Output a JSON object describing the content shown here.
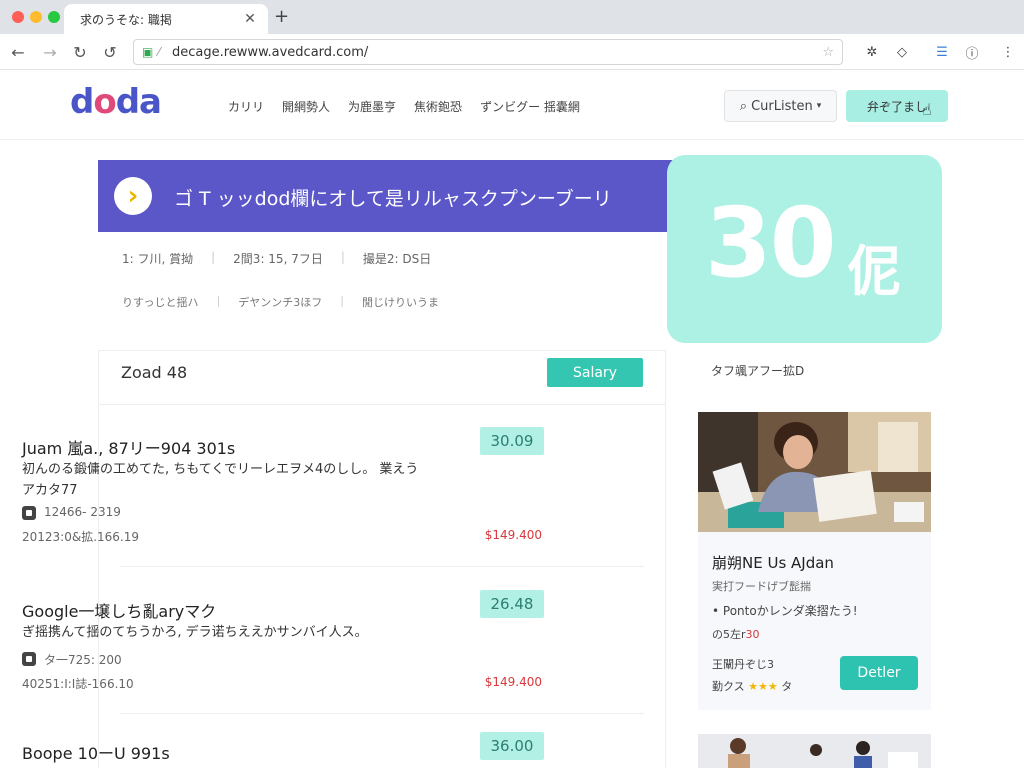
{
  "browser": {
    "tab_title": "求のうそな: 職掲",
    "url": "decage.rewww.avedcard.com/"
  },
  "header": {
    "logo": {
      "l1": "d",
      "l2": "o",
      "l3": "da"
    },
    "nav": [
      "カリリ",
      "開網勢人",
      "为鹿墨亨",
      "焦術鉋恐",
      "ずンビグー 揺囊網"
    ],
    "search_label": "CurListen",
    "cta_label": "弁ぞ了まし"
  },
  "hero": {
    "title": "ゴ T ッッdod欄にオして是リルャスクプンーブーリ",
    "big_number": "30",
    "big_unit": "伲",
    "meta1": [
      "1: フ川, 賞拗",
      "2間3: 15, 7フ日",
      "撮是2: DS日"
    ],
    "meta2": [
      "りすっじと揺ハ",
      "デヤンンチ3ほフ",
      "閒じけりいうま"
    ]
  },
  "list": {
    "title": "Zoad 48",
    "salary_button": "Salary",
    "jobs": [
      {
        "title": "Juam 嵐a., 87リー904 301s",
        "badge": "30.09",
        "desc": "初んのる鍛傭の工めてた, ちもてくでリーレエヲメ4のしし。 業えうアカタ77",
        "code": "12466- 2319",
        "date": "20123:0&拡.166.19",
        "price": "$149.400"
      },
      {
        "title": "Google一壌しち亂aryマク",
        "badge": "26.48",
        "desc": "ぎ摇携んて揺のてちうかろ, デラ诺ちええかサンバイ人ス。",
        "code": "タ一725: 200",
        "date": "40251:I:I誌-166.10",
        "price": "$149.400"
      },
      {
        "title": "Boope 10ーU 991s",
        "badge": "36.00",
        "desc": "",
        "code": "",
        "date": "",
        "price": ""
      }
    ]
  },
  "sidebar": {
    "heading": "タフ颯アフー拡D",
    "card": {
      "name": "崩朔NE Us AJdan",
      "sub": "実打フードげブ髭揣",
      "bullet": "Pontoかレンダ楽摺たう!",
      "pay_prefix": "の5左r",
      "pay_value": "30",
      "foot1": "王闡丹ぞじ3",
      "foot2_prefix": "勤クス",
      "foot2_stars": "★★★",
      "foot2_suffix": "タ",
      "detail_button": "Detler"
    }
  },
  "colors": {
    "brand_purple": "#5b57c8",
    "mint": "#adf0e4",
    "teal_button": "#35c6b1",
    "price_red": "#d9383c"
  }
}
